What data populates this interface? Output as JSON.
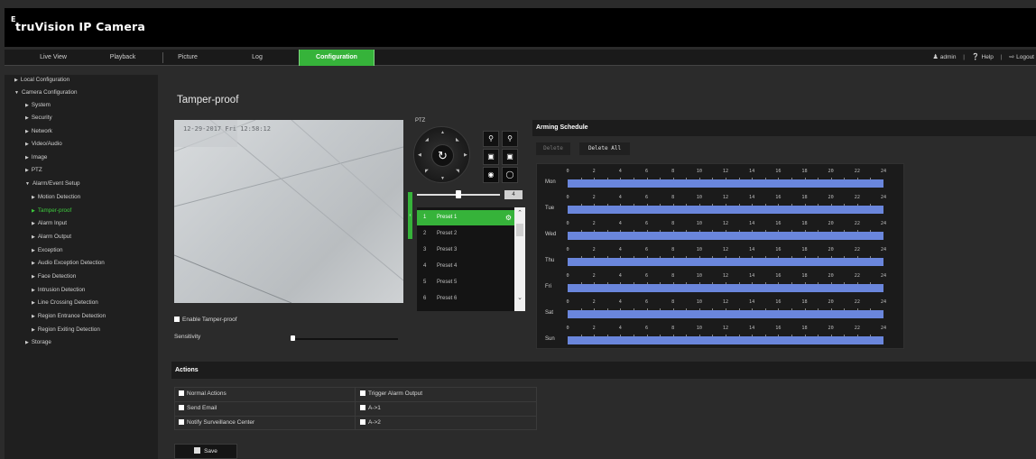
{
  "header": {
    "logo_prefix": "E",
    "logo_text": "truVision IP Camera"
  },
  "nav": {
    "tabs": [
      {
        "label": "Live View"
      },
      {
        "label": "Playback"
      },
      {
        "label": "Picture"
      },
      {
        "label": "Log"
      },
      {
        "label": "Configuration",
        "active": true
      }
    ],
    "user": {
      "name": "admin",
      "help": "Help",
      "logout": "Logout"
    }
  },
  "sidebar": {
    "items": [
      {
        "label": "Local Configuration",
        "icon": "triangle-right-icon"
      },
      {
        "label": "Camera Configuration",
        "icon": "triangle-down-icon"
      },
      {
        "label": "System",
        "icon": "triangle-right-icon"
      },
      {
        "label": "Security",
        "icon": "triangle-right-icon"
      },
      {
        "label": "Network",
        "icon": "triangle-right-icon"
      },
      {
        "label": "Video/Audio",
        "icon": "triangle-right-icon"
      },
      {
        "label": "Image",
        "icon": "triangle-right-icon"
      },
      {
        "label": "PTZ",
        "icon": "triangle-right-icon"
      },
      {
        "label": "Alarm/Event Setup",
        "icon": "triangle-down-icon"
      },
      {
        "label": "Motion Detection",
        "icon": "triangle-right-icon"
      },
      {
        "label": "Tamper-proof",
        "icon": "triangle-right-icon",
        "active": true
      },
      {
        "label": "Alarm Input",
        "icon": "triangle-right-icon"
      },
      {
        "label": "Alarm Output",
        "icon": "triangle-right-icon"
      },
      {
        "label": "Exception",
        "icon": "triangle-right-icon"
      },
      {
        "label": "Audio Exception Detection",
        "icon": "triangle-right-icon"
      },
      {
        "label": "Face Detection",
        "icon": "triangle-right-icon"
      },
      {
        "label": "Intrusion Detection",
        "icon": "triangle-right-icon"
      },
      {
        "label": "Line Crossing Detection",
        "icon": "triangle-right-icon"
      },
      {
        "label": "Region Entrance Detection",
        "icon": "triangle-right-icon"
      },
      {
        "label": "Region Exiting Detection",
        "icon": "triangle-right-icon"
      },
      {
        "label": "Storage",
        "icon": "triangle-right-icon"
      }
    ]
  },
  "page": {
    "title": "Tamper-proof"
  },
  "video": {
    "osd": "12-29-2017 Fri 12:58:12"
  },
  "settings": {
    "enable_label": "Enable Tamper-proof",
    "enabled": false,
    "sensitivity_label": "Sensitivity",
    "sensitivity_fraction": 0.0
  },
  "ptz": {
    "label": "PTZ",
    "speed_value": "4",
    "speed_fraction": 0.5,
    "presets": [
      {
        "num": "1",
        "name": "Preset 1",
        "selected": true
      },
      {
        "num": "2",
        "name": "Preset 2"
      },
      {
        "num": "3",
        "name": "Preset 3"
      },
      {
        "num": "4",
        "name": "Preset 4"
      },
      {
        "num": "5",
        "name": "Preset 5"
      },
      {
        "num": "6",
        "name": "Preset 6"
      }
    ]
  },
  "schedule": {
    "title": "Arming Schedule",
    "delete_label": "Delete",
    "delete_all_label": "Delete All",
    "days": [
      "Mon",
      "Tue",
      "Wed",
      "Thu",
      "Fri",
      "Sat",
      "Sun"
    ],
    "hour_labels": [
      "0",
      "2",
      "4",
      "6",
      "8",
      "10",
      "12",
      "14",
      "16",
      "18",
      "20",
      "22",
      "24"
    ],
    "armed": [
      [
        0,
        24
      ],
      [
        0,
        24
      ],
      [
        0,
        24
      ],
      [
        0,
        24
      ],
      [
        0,
        24
      ],
      [
        0,
        24
      ],
      [
        0,
        24
      ]
    ],
    "color": "#6a86dc"
  },
  "actions": {
    "title": "Actions",
    "left": [
      {
        "label": "Normal Actions"
      },
      {
        "label": "Send Email"
      },
      {
        "label": "Notify Surveillance Center"
      }
    ],
    "right": [
      {
        "label": "Trigger Alarm Output"
      },
      {
        "label": "A->1"
      },
      {
        "label": "A->2"
      }
    ]
  },
  "save_label": "Save",
  "colors": {
    "accent": "#36b33a",
    "active_text": "#3ecc3e",
    "background": "#2b2b2b"
  }
}
